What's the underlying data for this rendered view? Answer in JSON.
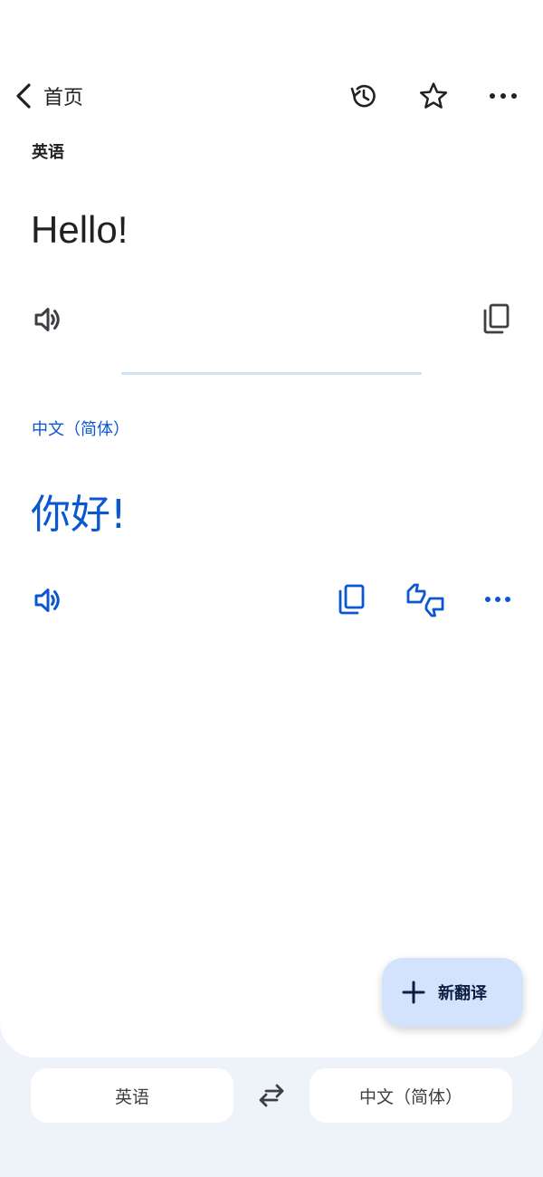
{
  "header": {
    "back_label": "首页",
    "icons": [
      "history-icon",
      "star-icon",
      "more-icon"
    ]
  },
  "source": {
    "language": "英语",
    "text": "Hello!"
  },
  "target": {
    "language": "中文（简体）",
    "text": "你好!"
  },
  "fab": {
    "label": "新翻译"
  },
  "bottom_bar": {
    "source_language": "英语",
    "target_language": "中文（简体）"
  },
  "colors": {
    "accent": "#0b57d0",
    "fab_bg": "#d3e3fd",
    "bg": "#eef2f9"
  }
}
